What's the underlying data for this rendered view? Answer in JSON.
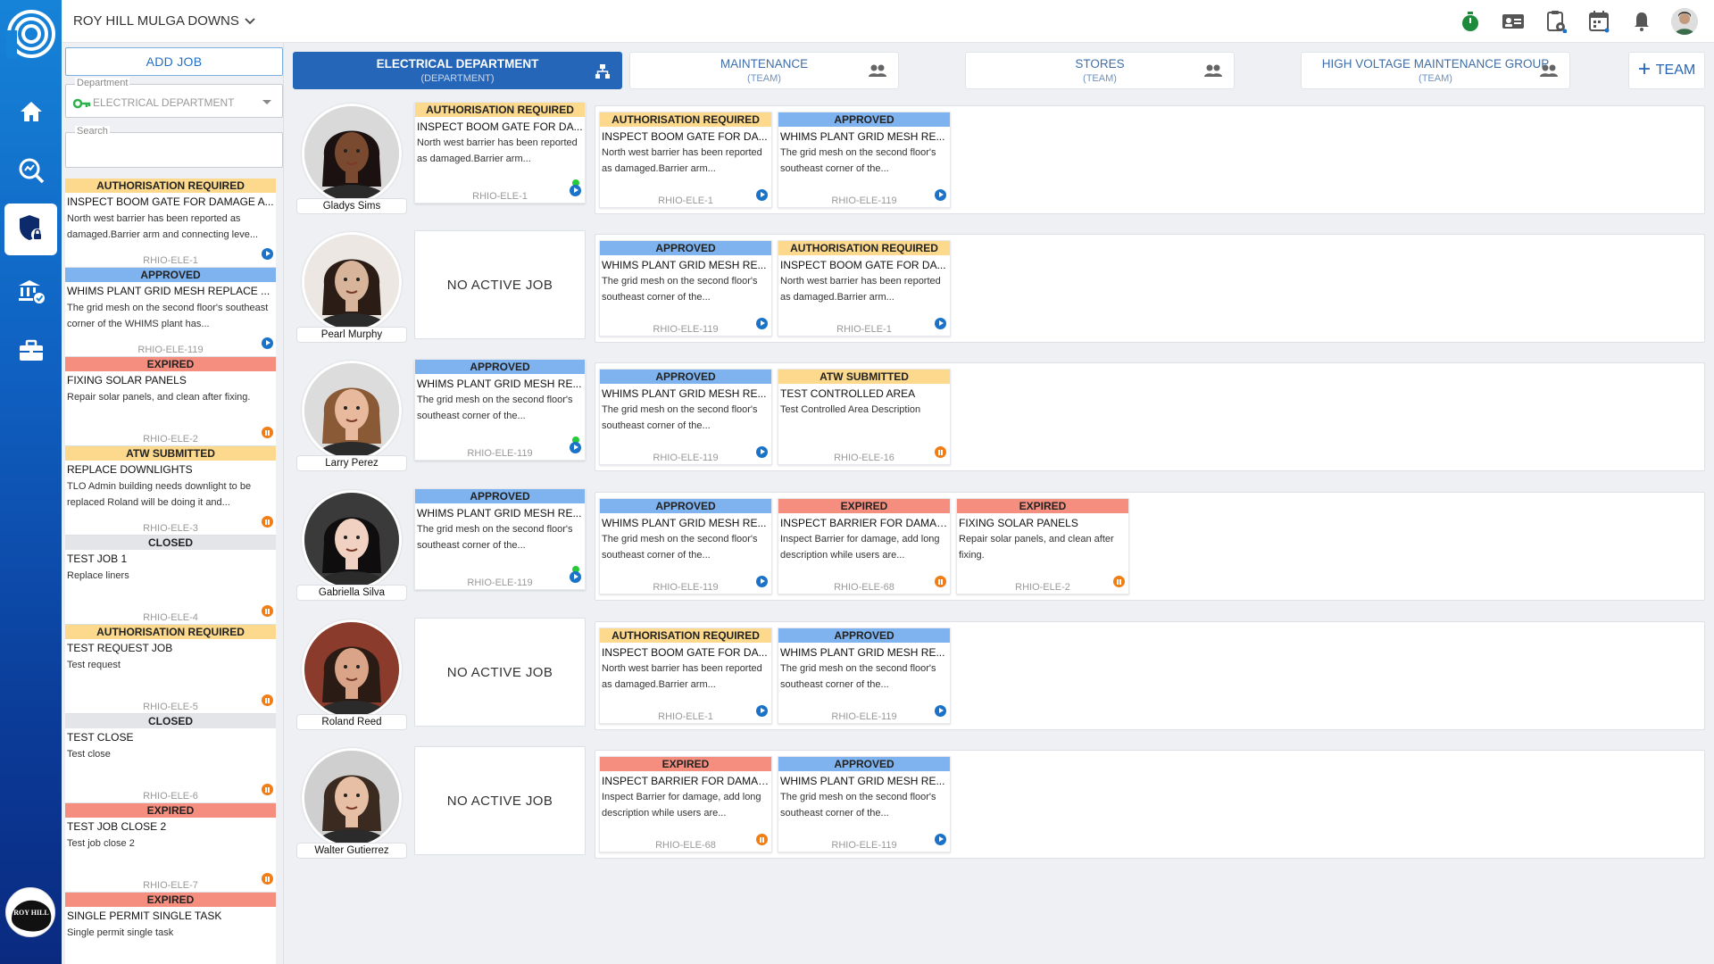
{
  "site": {
    "name": "ROY HILL MULGA DOWNS"
  },
  "sidebar": {
    "items": [
      {
        "icon": "home-icon"
      },
      {
        "icon": "search-analytics-icon"
      },
      {
        "icon": "shield-lock-icon",
        "active": true
      },
      {
        "icon": "bank-check-icon"
      },
      {
        "icon": "briefcase-icon"
      }
    ],
    "org_logo_text": "ROY HILL"
  },
  "left": {
    "add_job_label": "ADD JOB",
    "department_label": "Department",
    "department_value": "ELECTRICAL DEPARTMENT",
    "search_label": "Search",
    "jobs": [
      {
        "status": "AUTHORISATION REQUIRED",
        "cls": "c-auth",
        "title": "INSPECT BOOM GATE FOR DAMAGE A...",
        "desc": "North west barrier has been reported as damaged.Barrier arm and connecting leve...",
        "code": "RHIO-ELE-1",
        "ind": "play"
      },
      {
        "status": "APPROVED",
        "cls": "c-appr",
        "title": "WHIMS PLANT GRID MESH REPLACE ...",
        "desc": "The grid mesh on the second floor's southeast corner of the WHIMS plant has...",
        "code": "RHIO-ELE-119",
        "ind": "play"
      },
      {
        "status": "EXPIRED",
        "cls": "c-exp",
        "title": "FIXING SOLAR PANELS",
        "desc": "Repair solar panels, and clean after fixing.",
        "code": "RHIO-ELE-2",
        "ind": "pause"
      },
      {
        "status": "ATW SUBMITTED",
        "cls": "c-atw",
        "title": "REPLACE DOWNLIGHTS",
        "desc": "TLO Admin building needs downlight to be replaced Roland will be doing it and...",
        "code": "RHIO-ELE-3",
        "ind": "pause"
      },
      {
        "status": "CLOSED",
        "cls": "c-closed",
        "title": "TEST JOB 1",
        "desc": "Replace liners",
        "code": "RHIO-ELE-4",
        "ind": "pause"
      },
      {
        "status": "AUTHORISATION REQUIRED",
        "cls": "c-auth",
        "title": "TEST REQUEST JOB",
        "desc": "Test request",
        "code": "RHIO-ELE-5",
        "ind": "pause"
      },
      {
        "status": "CLOSED",
        "cls": "c-closed",
        "title": "TEST CLOSE",
        "desc": "Test close",
        "code": "RHIO-ELE-6",
        "ind": "pause"
      },
      {
        "status": "EXPIRED",
        "cls": "c-exp",
        "title": "TEST JOB CLOSE 2",
        "desc": "Test job close 2",
        "code": "RHIO-ELE-7",
        "ind": "pause"
      },
      {
        "status": "EXPIRED",
        "cls": "c-exp",
        "title": "SINGLE PERMIT SINGLE TASK",
        "desc": "Single permit single task",
        "code": "",
        "ind": ""
      }
    ]
  },
  "tabs": [
    {
      "name": "ELECTRICAL DEPARTMENT",
      "kind": "(DEPARTMENT)",
      "active": true,
      "icon": "org-chart-icon"
    },
    {
      "name": "MAINTENANCE",
      "kind": "(TEAM)",
      "active": false,
      "icon": "team-icon"
    },
    {
      "name": "STORES",
      "kind": "(TEAM)",
      "active": false,
      "icon": "team-icon"
    },
    {
      "name": "HIGH VOLTAGE MAINTENANCE GROUP",
      "kind": "(TEAM)",
      "active": false,
      "icon": "team-icon"
    }
  ],
  "team_button": {
    "label": "TEAM"
  },
  "no_active_label": "NO ACTIVE JOB",
  "members": [
    {
      "name": "Gladys Sims",
      "skin": "#7a4a30",
      "hair": "#1a1110",
      "bg": "#d9d9d9",
      "active": {
        "status": "AUTHORISATION REQUIRED",
        "cls": "c-auth",
        "title": "INSPECT BOOM GATE FOR DA...",
        "desc": "North west barrier has been reported as damaged.Barrier arm...",
        "code": "RHIO-ELE-1",
        "ind": "play",
        "dot": true
      },
      "queue": [
        {
          "status": "AUTHORISATION REQUIRED",
          "cls": "c-auth",
          "title": "INSPECT BOOM GATE FOR DA...",
          "desc": "North west barrier has been reported as damaged.Barrier arm...",
          "code": "RHIO-ELE-1",
          "ind": "play"
        },
        {
          "status": "APPROVED",
          "cls": "c-appr",
          "title": "WHIMS PLANT GRID MESH RE...",
          "desc": "The grid mesh on the second floor's southeast corner of the...",
          "code": "RHIO-ELE-119",
          "ind": "play"
        }
      ]
    },
    {
      "name": "Pearl Murphy",
      "skin": "#d8b59a",
      "hair": "#2b1d16",
      "bg": "#ece7e3",
      "active": null,
      "queue": [
        {
          "status": "APPROVED",
          "cls": "c-appr",
          "title": "WHIMS PLANT GRID MESH RE...",
          "desc": "The grid mesh on the second floor's southeast corner of the...",
          "code": "RHIO-ELE-119",
          "ind": "play"
        },
        {
          "status": "AUTHORISATION REQUIRED",
          "cls": "c-auth",
          "title": "INSPECT BOOM GATE FOR DA...",
          "desc": "North west barrier has been reported as damaged.Barrier arm...",
          "code": "RHIO-ELE-1",
          "ind": "play"
        }
      ]
    },
    {
      "name": "Larry Perez",
      "skin": "#e8b99c",
      "hair": "#8a5a36",
      "bg": "#dcdcdc",
      "active": {
        "status": "APPROVED",
        "cls": "c-appr",
        "title": "WHIMS PLANT GRID MESH RE...",
        "desc": "The grid mesh on the second floor's southeast corner of the...",
        "code": "RHIO-ELE-119",
        "ind": "play",
        "dot": true
      },
      "queue": [
        {
          "status": "APPROVED",
          "cls": "c-appr",
          "title": "WHIMS PLANT GRID MESH RE...",
          "desc": "The grid mesh on the second floor's southeast corner of the...",
          "code": "RHIO-ELE-119",
          "ind": "play"
        },
        {
          "status": "ATW SUBMITTED",
          "cls": "c-atw",
          "title": "TEST CONTROLLED AREA",
          "desc": "Test Controlled Area Description",
          "code": "RHIO-ELE-16",
          "ind": "pause"
        }
      ]
    },
    {
      "name": "Gabriella Silva",
      "skin": "#f1d2c2",
      "hair": "#0f0d0e",
      "bg": "#3a3a3a",
      "active": {
        "status": "APPROVED",
        "cls": "c-appr",
        "title": "WHIMS PLANT GRID MESH RE...",
        "desc": "The grid mesh on the second floor's southeast corner of the...",
        "code": "RHIO-ELE-119",
        "ind": "play",
        "dot": true
      },
      "queue": [
        {
          "status": "APPROVED",
          "cls": "c-appr",
          "title": "WHIMS PLANT GRID MESH RE...",
          "desc": "The grid mesh on the second floor's southeast corner of the...",
          "code": "RHIO-ELE-119",
          "ind": "play"
        },
        {
          "status": "EXPIRED",
          "cls": "c-exp",
          "title": "INSPECT BARRIER FOR DAMAGE",
          "desc": "Inspect Barrier for damage, add long description while users are...",
          "code": "RHIO-ELE-68",
          "ind": "pause"
        },
        {
          "status": "EXPIRED",
          "cls": "c-exp",
          "title": "FIXING SOLAR PANELS",
          "desc": "Repair solar panels, and clean after fixing.",
          "code": "RHIO-ELE-2",
          "ind": "pause"
        }
      ]
    },
    {
      "name": "Roland Reed",
      "skin": "#d9a487",
      "hair": "#2a1c14",
      "bg": "#8b3b2b",
      "active": null,
      "queue": [
        {
          "status": "AUTHORISATION REQUIRED",
          "cls": "c-auth",
          "title": "INSPECT BOOM GATE FOR DA...",
          "desc": "North west barrier has been reported as damaged.Barrier arm...",
          "code": "RHIO-ELE-1",
          "ind": "play"
        },
        {
          "status": "APPROVED",
          "cls": "c-appr",
          "title": "WHIMS PLANT GRID MESH RE...",
          "desc": "The grid mesh on the second floor's southeast corner of the...",
          "code": "RHIO-ELE-119",
          "ind": "play"
        }
      ]
    },
    {
      "name": "Walter Gutierrez",
      "skin": "#e6bfa5",
      "hair": "#3a2a20",
      "bg": "#cfcfcf",
      "active": null,
      "queue": [
        {
          "status": "EXPIRED",
          "cls": "c-exp",
          "title": "INSPECT BARRIER FOR DAMAGE",
          "desc": "Inspect Barrier for damage, add long description while users are...",
          "code": "RHIO-ELE-68",
          "ind": "pause"
        },
        {
          "status": "APPROVED",
          "cls": "c-appr",
          "title": "WHIMS PLANT GRID MESH RE...",
          "desc": "The grid mesh on the second floor's southeast corner of the...",
          "code": "RHIO-ELE-119",
          "ind": "play"
        }
      ]
    }
  ]
}
